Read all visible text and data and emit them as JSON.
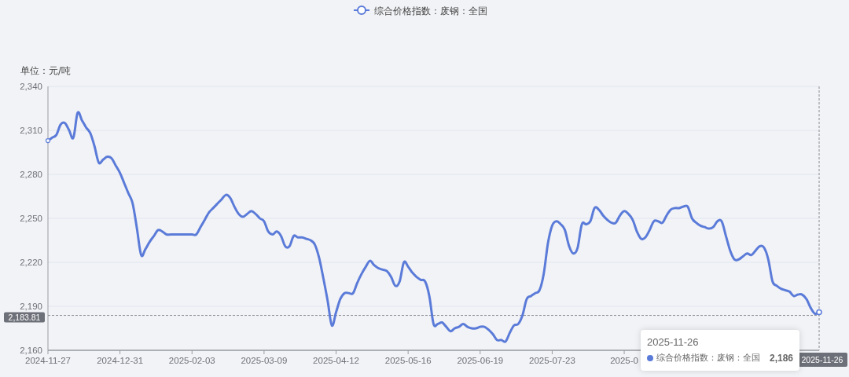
{
  "chart_data": {
    "type": "line",
    "ylabel": "单位：元/吨",
    "categories": [
      "2024-11-27",
      null,
      null,
      null,
      null,
      null,
      null,
      null,
      null,
      null,
      null,
      null,
      null,
      null,
      null,
      null,
      null,
      "2024-12-31",
      null,
      null,
      null,
      null,
      null,
      null,
      null,
      null,
      null,
      null,
      null,
      null,
      null,
      null,
      null,
      null,
      "2025-02-03",
      null,
      null,
      null,
      null,
      null,
      null,
      null,
      null,
      null,
      null,
      null,
      null,
      null,
      null,
      null,
      null,
      "2025-03-09",
      null,
      null,
      null,
      null,
      null,
      null,
      null,
      null,
      null,
      null,
      null,
      null,
      null,
      null,
      null,
      null,
      "2025-04-12",
      null,
      null,
      null,
      null,
      null,
      null,
      null,
      null,
      null,
      null,
      null,
      null,
      null,
      null,
      null,
      null,
      "2025-05-16",
      null,
      null,
      null,
      null,
      null,
      null,
      null,
      null,
      null,
      null,
      null,
      null,
      null,
      null,
      null,
      null,
      "2025-06-19",
      null,
      null,
      null,
      null,
      null,
      null,
      null,
      null,
      null,
      null,
      null,
      null,
      null,
      null,
      null,
      null,
      "2025-07-23",
      null,
      null,
      null,
      null,
      null,
      null,
      null,
      null,
      null,
      null,
      null,
      null,
      null,
      null,
      null,
      null,
      "2025-0",
      null,
      null,
      null,
      null,
      null,
      null,
      null,
      null,
      null,
      null,
      null,
      null,
      null,
      null,
      null,
      null,
      null,
      null,
      null,
      null,
      null,
      null,
      null,
      null,
      null,
      null,
      null,
      null,
      null,
      null,
      null,
      null,
      null,
      null,
      null,
      null,
      null,
      null,
      null,
      null,
      null,
      null,
      null,
      null,
      null,
      null
    ],
    "series": [
      {
        "name": "综合价格指数：废钢：全国",
        "color": "#5b7bd9",
        "values": [
          2303,
          2305,
          2307,
          2314,
          2315,
          2310,
          2305,
          2322,
          2317,
          2312,
          2308,
          2299,
          2288,
          2290,
          2292,
          2291,
          2286,
          2281,
          2274,
          2267,
          2260,
          2243,
          2225,
          2229,
          2234,
          2238,
          2242,
          2241,
          2239,
          2239,
          2239,
          2239,
          2239,
          2239,
          2239,
          2239,
          2244,
          2249,
          2254,
          2257,
          2260,
          2263,
          2266,
          2264,
          2258,
          2253,
          2251,
          2253,
          2255,
          2253,
          2250,
          2248,
          2241,
          2239,
          2241,
          2238,
          2231,
          2231,
          2238,
          2237,
          2237,
          2236,
          2235,
          2232,
          2223,
          2209,
          2194,
          2177,
          2186,
          2195,
          2199,
          2199,
          2199,
          2206,
          2212,
          2217,
          2221,
          2218,
          2216,
          2215,
          2214,
          2210,
          2204,
          2207,
          2220,
          2217,
          2213,
          2210,
          2208,
          2207,
          2197,
          2178,
          2178,
          2179,
          2176,
          2173,
          2175,
          2176,
          2178,
          2176,
          2175,
          2175,
          2176,
          2176,
          2174,
          2171,
          2167,
          2167,
          2166,
          2172,
          2177,
          2178,
          2184,
          2195,
          2197,
          2199,
          2201,
          2212,
          2233,
          2245,
          2248,
          2246,
          2242,
          2231,
          2226,
          2230,
          2246,
          2246,
          2248,
          2257,
          2256,
          2252,
          2249,
          2247,
          2247,
          2252,
          2255,
          2253,
          2249,
          2241,
          2236,
          2237,
          2242,
          2248,
          2248,
          2247,
          2252,
          2256,
          2257,
          2257,
          2258,
          2258,
          2250,
          2247,
          2245,
          2244,
          2243,
          2244,
          2248,
          2248,
          2238,
          2228,
          2222,
          2222,
          2224,
          2226,
          2225,
          2228,
          2231,
          2230,
          2222,
          2207,
          2204,
          2202,
          2201,
          2200,
          2197,
          2198,
          2198,
          2195,
          2189,
          2185,
          2186
        ]
      }
    ],
    "ylim": [
      2160,
      2340
    ],
    "grid": true,
    "ref_lines": [
      {
        "axis": "y",
        "value": 2183.81,
        "label": "2,183.81"
      }
    ],
    "yticks": [
      {
        "value": 2160,
        "label": "2,160"
      },
      {
        "value": 2190,
        "label": "2,190"
      },
      {
        "value": 2220,
        "label": "2,220"
      },
      {
        "value": 2250,
        "label": "2,250"
      },
      {
        "value": 2280,
        "label": "2,280"
      },
      {
        "value": 2310,
        "label": "2,310"
      },
      {
        "value": 2340,
        "label": "2,340"
      }
    ]
  },
  "x_pointer": {
    "label": "2025-11-26"
  },
  "tooltip": {
    "title": "2025-11-26",
    "items": [
      {
        "name": "综合价格指数：废钢：全国",
        "value": "2,186"
      }
    ]
  }
}
